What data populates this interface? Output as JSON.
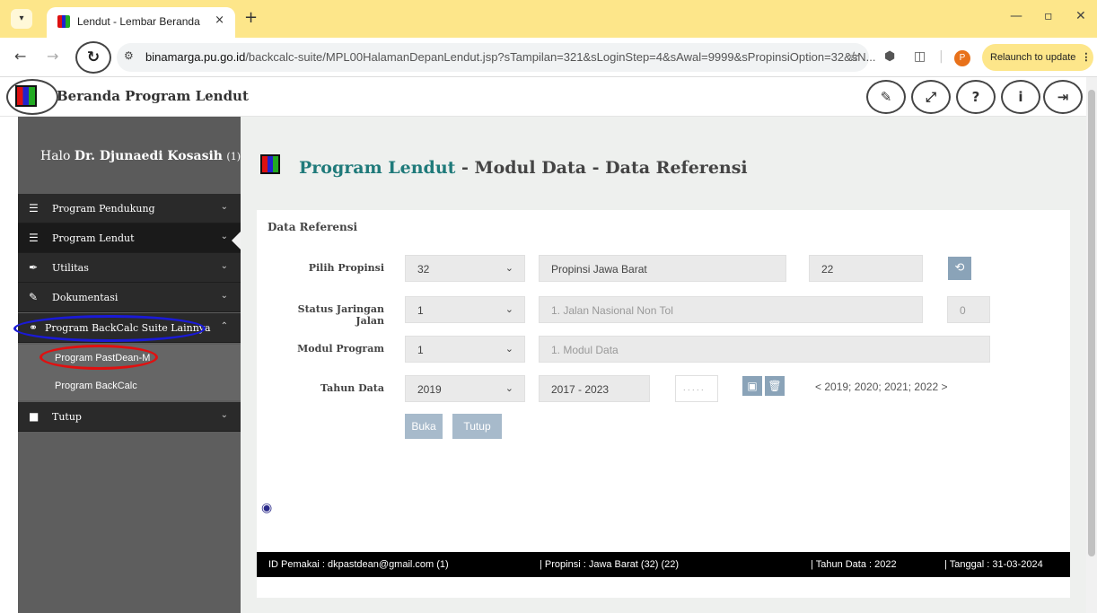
{
  "browser": {
    "tab_title": "Lendut - Lembar Beranda",
    "tab_close": "×",
    "new_tab": "+",
    "url_host": "binamarga.pu.go.id",
    "url_path": "/backcalc-suite/MPL00HalamanDepanLendut.jsp?sTampilan=321&sLoginStep=4&sAwal=9999&sPropinsiOption=32&sN...",
    "profile_initial": "P",
    "relaunch_label": "Relaunch to update"
  },
  "header": {
    "title": "Beranda Program Lendut",
    "buttons": [
      "pencil-icon",
      "expand-icon",
      "help-icon",
      "info-icon",
      "logout-icon"
    ]
  },
  "sidebar": {
    "greeting_prefix": "Halo",
    "user_name": "Dr. Djunaedi Kosasih",
    "user_id": "(1)",
    "items": [
      {
        "label": "Program Pendukung",
        "icon": "list-icon"
      },
      {
        "label": "Program Lendut",
        "icon": "list-icon"
      },
      {
        "label": "Utilitas",
        "icon": "feather-icon"
      },
      {
        "label": "Dokumentasi",
        "icon": "pencil-icon"
      },
      {
        "label": "Program BackCalc Suite Lainnya",
        "icon": "link-icon"
      },
      {
        "label": "Tutup",
        "icon": "stop-icon"
      }
    ],
    "sub_items": [
      "Program PastDean-M",
      "Program BackCalc"
    ]
  },
  "main": {
    "title_highlight": "Program Lendut",
    "title_rest": " - Modul Data - Data Referensi",
    "panel_title": "Data Referensi",
    "form": {
      "propinsi_label": "Pilih Propinsi",
      "propinsi_value": "32",
      "propinsi_name": "Propinsi Jawa Barat",
      "propinsi_code": "22",
      "status_label": "Status Jaringan Jalan",
      "status_value": "1",
      "status_name": "1. Jalan Nasional Non Tol",
      "status_count": "0",
      "modul_label": "Modul Program",
      "modul_value": "1",
      "modul_name": "1. Modul Data",
      "tahun_label": "Tahun Data",
      "tahun_value": "2019",
      "tahun_range": "2017 - 2023",
      "tahun_extra": ". . . . .",
      "years_note": "< 2019; 2020; 2021; 2022 >"
    },
    "buka_label": "Buka",
    "tutup_label": "Tutup"
  },
  "status_bar": {
    "user": "ID Pemakai : dkpastdean@gmail.com (1)",
    "propinsi": "| Propinsi : Jawa Barat (32) (22)",
    "tahun": "| Tahun Data : 2022",
    "tanggal": "| Tanggal : 31-03-2024"
  },
  "colors": {
    "title_accent": "#1f7a7a",
    "sidebar_bg": "#5e5e5e",
    "nav_bg": "#2a2a2a",
    "blue_highlight": "#1a1ad6",
    "red_highlight": "#e01010",
    "chrome_tab_bar": "#fde68a"
  }
}
